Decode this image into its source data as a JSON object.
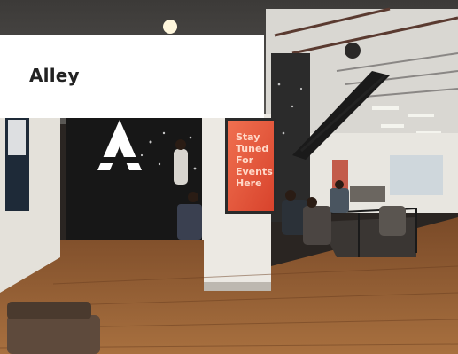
{
  "card": {
    "title": "Alley",
    "sign_text": [
      "Stay",
      "Tuned",
      "For",
      "Events",
      "Here"
    ],
    "colors": {
      "panel": "#ffffff",
      "title": "#222222",
      "sign": "#e8553c",
      "floor": "#8a5530",
      "wall": "#e9e6e0"
    }
  }
}
